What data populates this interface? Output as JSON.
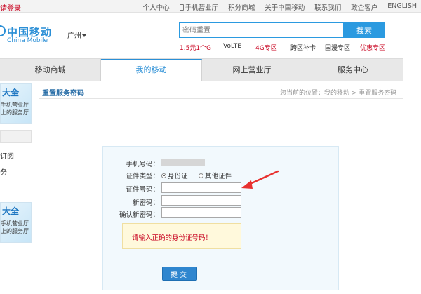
{
  "topbar": {
    "login": "请登录",
    "links": [
      "个人中心",
      "手机营业厅",
      "积分商城",
      "关于中国移动",
      "联系我们",
      "政企客户",
      "ENGLISH"
    ]
  },
  "header": {
    "logo_cn": "中国移动",
    "logo_en": "China Mobile",
    "city": "广州",
    "search_placeholder": "密码重置",
    "search_button": "搜索",
    "hotlinks": [
      {
        "label": "1.5元1个G",
        "color": "#c8001e"
      },
      {
        "label": "VoLTE",
        "color": "#333333"
      },
      {
        "label": "4G专区",
        "color": "#c8001e"
      },
      {
        "label": "跨区补卡",
        "color": "#333333"
      },
      {
        "label": "国漫专区",
        "color": "#333333"
      },
      {
        "label": "优惠专区",
        "color": "#c8001e"
      }
    ]
  },
  "nav": {
    "items": [
      "移动商城",
      "我的移动",
      "网上营业厅",
      "服务中心"
    ],
    "active": "我的移动"
  },
  "sidebar": {
    "banner_title": "大全",
    "banner_line1": "手机营业厅",
    "banner_line2": "上的服务厅",
    "items": [
      "订阅",
      "务"
    ]
  },
  "page": {
    "title": "重置服务密码",
    "breadcrumb": "您当前的位置：我的移动 > 重置服务密码"
  },
  "form": {
    "phone_label": "手机号码：",
    "id_type_label": "证件类型：",
    "id_type_options": [
      "身份证",
      "其他证件"
    ],
    "id_number_label": "证件号码：",
    "new_password_label": "新密码：",
    "confirm_password_label": "确认新密码：",
    "error_message": "请输入正确的身份证号码！",
    "submit_label": "提交"
  },
  "colors": {
    "brand_blue": "#2b8fd6",
    "error_red": "#c8001e",
    "annotation_arrow": "#e8312f"
  }
}
